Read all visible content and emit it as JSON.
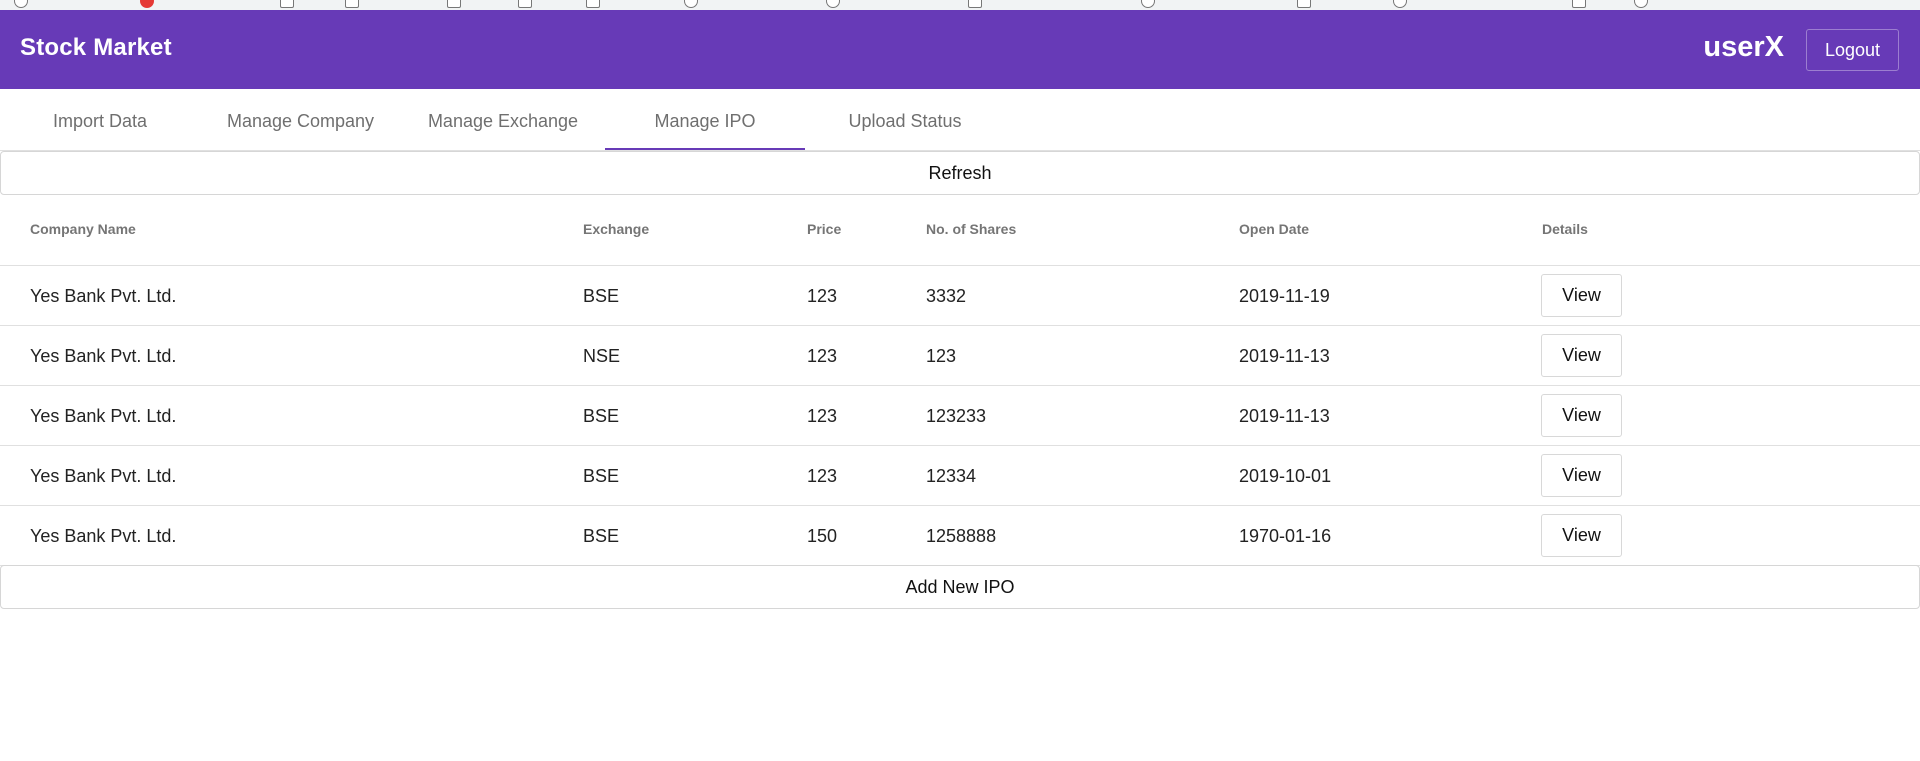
{
  "header": {
    "title": "Stock Market",
    "username": "userX",
    "logout_label": "Logout",
    "brand_color": "#673ab7"
  },
  "tabs": [
    {
      "label": "Import Data",
      "active": false
    },
    {
      "label": "Manage Company",
      "active": false
    },
    {
      "label": "Manage Exchange",
      "active": false
    },
    {
      "label": "Manage IPO",
      "active": true
    },
    {
      "label": "Upload Status",
      "active": false
    }
  ],
  "actions": {
    "refresh_label": "Refresh",
    "add_label": "Add New IPO"
  },
  "table": {
    "columns": [
      "Company Name",
      "Exchange",
      "Price",
      "No. of Shares",
      "Open Date",
      "Details"
    ],
    "view_label": "View",
    "rows": [
      {
        "company": "Yes Bank Pvt. Ltd.",
        "exchange": "BSE",
        "price": "123",
        "shares": "3332",
        "open_date": "2019-11-19"
      },
      {
        "company": "Yes Bank Pvt. Ltd.",
        "exchange": "NSE",
        "price": "123",
        "shares": "123",
        "open_date": "2019-11-13"
      },
      {
        "company": "Yes Bank Pvt. Ltd.",
        "exchange": "BSE",
        "price": "123",
        "shares": "123233",
        "open_date": "2019-11-13"
      },
      {
        "company": "Yes Bank Pvt. Ltd.",
        "exchange": "BSE",
        "price": "123",
        "shares": "12334",
        "open_date": "2019-10-01"
      },
      {
        "company": "Yes Bank Pvt. Ltd.",
        "exchange": "BSE",
        "price": "150",
        "shares": "1258888",
        "open_date": "1970-01-16"
      }
    ]
  }
}
